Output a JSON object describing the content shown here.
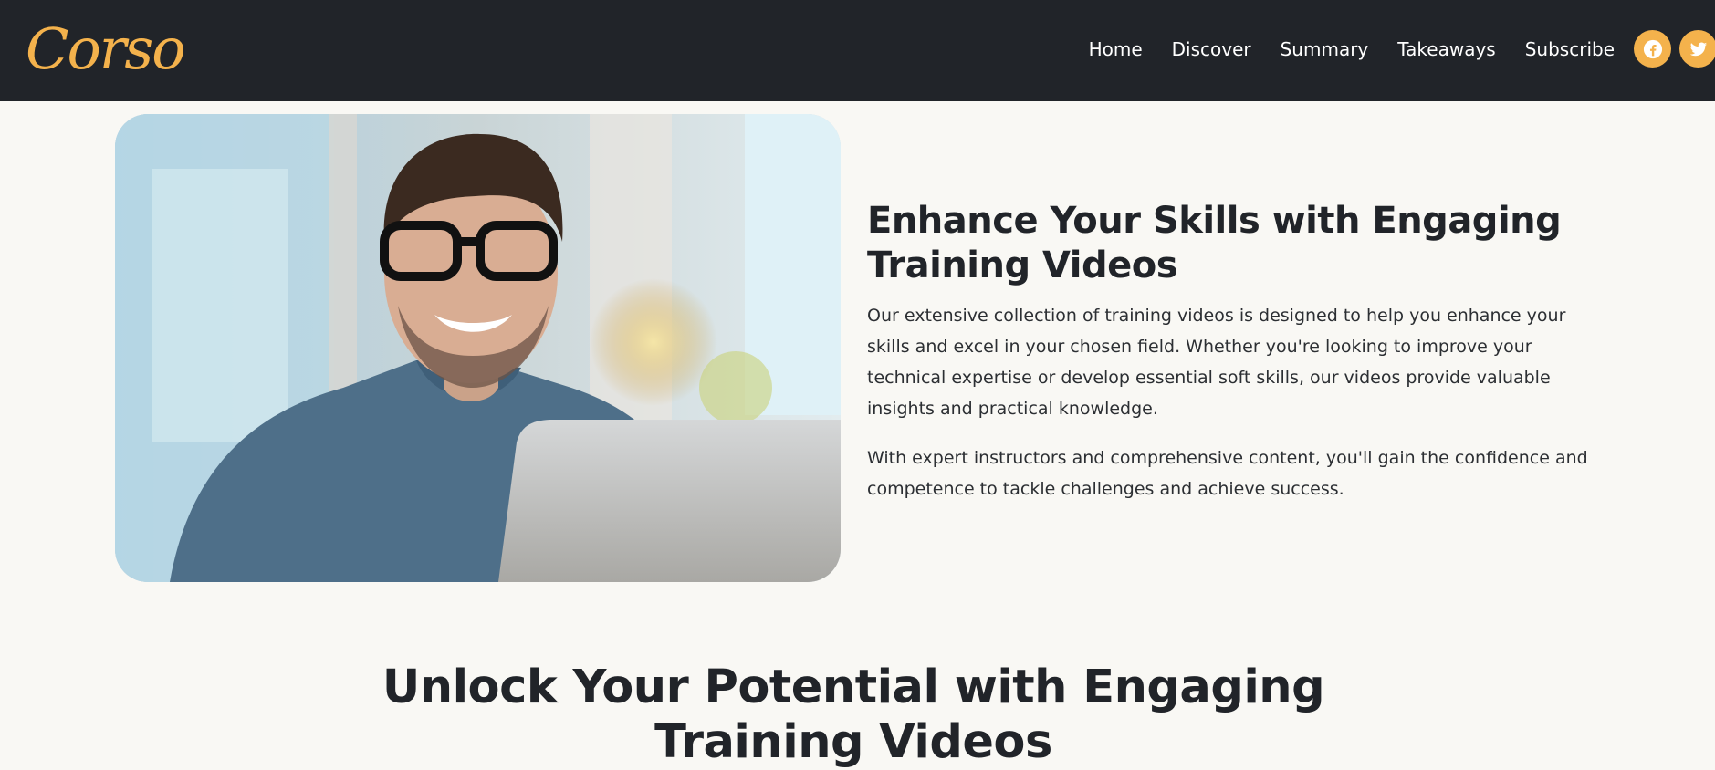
{
  "header": {
    "logo": "Corso",
    "nav": [
      {
        "label": "Home"
      },
      {
        "label": "Discover"
      },
      {
        "label": "Summary"
      },
      {
        "label": "Takeaways"
      },
      {
        "label": "Subscribe"
      }
    ],
    "social": [
      {
        "icon": "facebook-icon"
      },
      {
        "icon": "twitter-icon"
      }
    ]
  },
  "hero": {
    "title": "Enhance Your Skills with Engaging Training Videos",
    "paragraph1": "Our extensive collection of training videos is designed to help you enhance your skills and excel in your chosen field. Whether you're looking to improve your technical expertise or develop essential soft skills, our videos provide valuable insights and practical knowledge.",
    "paragraph2": "With expert instructors and comprehensive content, you'll gain the confidence and competence to tackle challenges and achieve success."
  },
  "section2": {
    "title": "Unlock Your Potential with Engaging Training Videos"
  },
  "colors": {
    "accent": "#f4b24c",
    "nav_bg": "#212429",
    "page_bg": "#f9f8f4"
  }
}
